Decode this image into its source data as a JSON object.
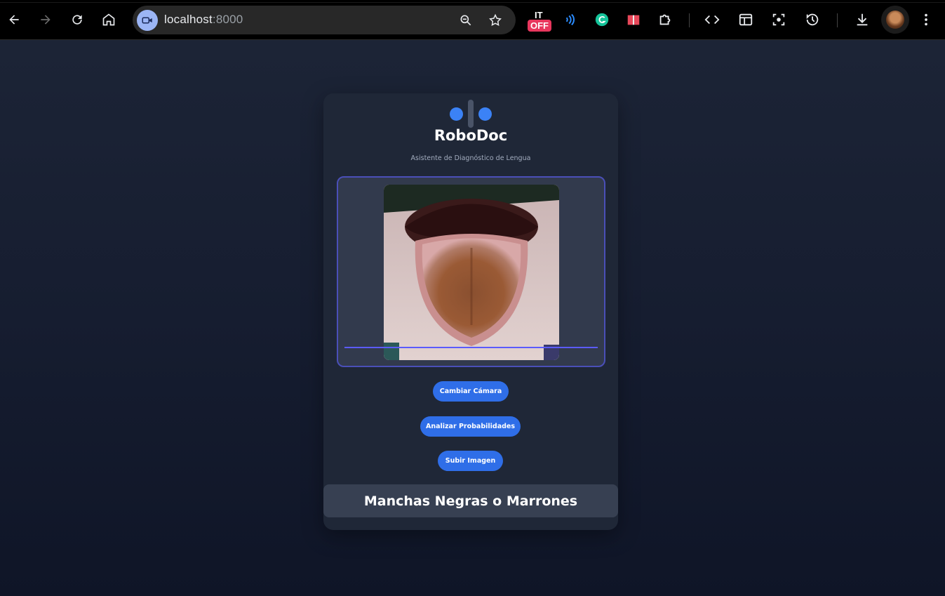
{
  "browser": {
    "url_host": "localhost",
    "url_port": ":8000",
    "extension_badge_top": "IT",
    "extension_badge_bottom": "OFF"
  },
  "app": {
    "brand": "RoboDoc",
    "subtitle": "Asistente de Diagnóstico de Lengua",
    "buttons": {
      "switch_camera": "Cambiar Cámara",
      "analyze": "Analizar Probabilidades",
      "upload": "Subir Imagen"
    },
    "result": "Manchas Negras o Marrones"
  },
  "colors": {
    "accent": "#3b82f6",
    "button": "#2f6ee8",
    "scan_line": "#5b5bff"
  }
}
